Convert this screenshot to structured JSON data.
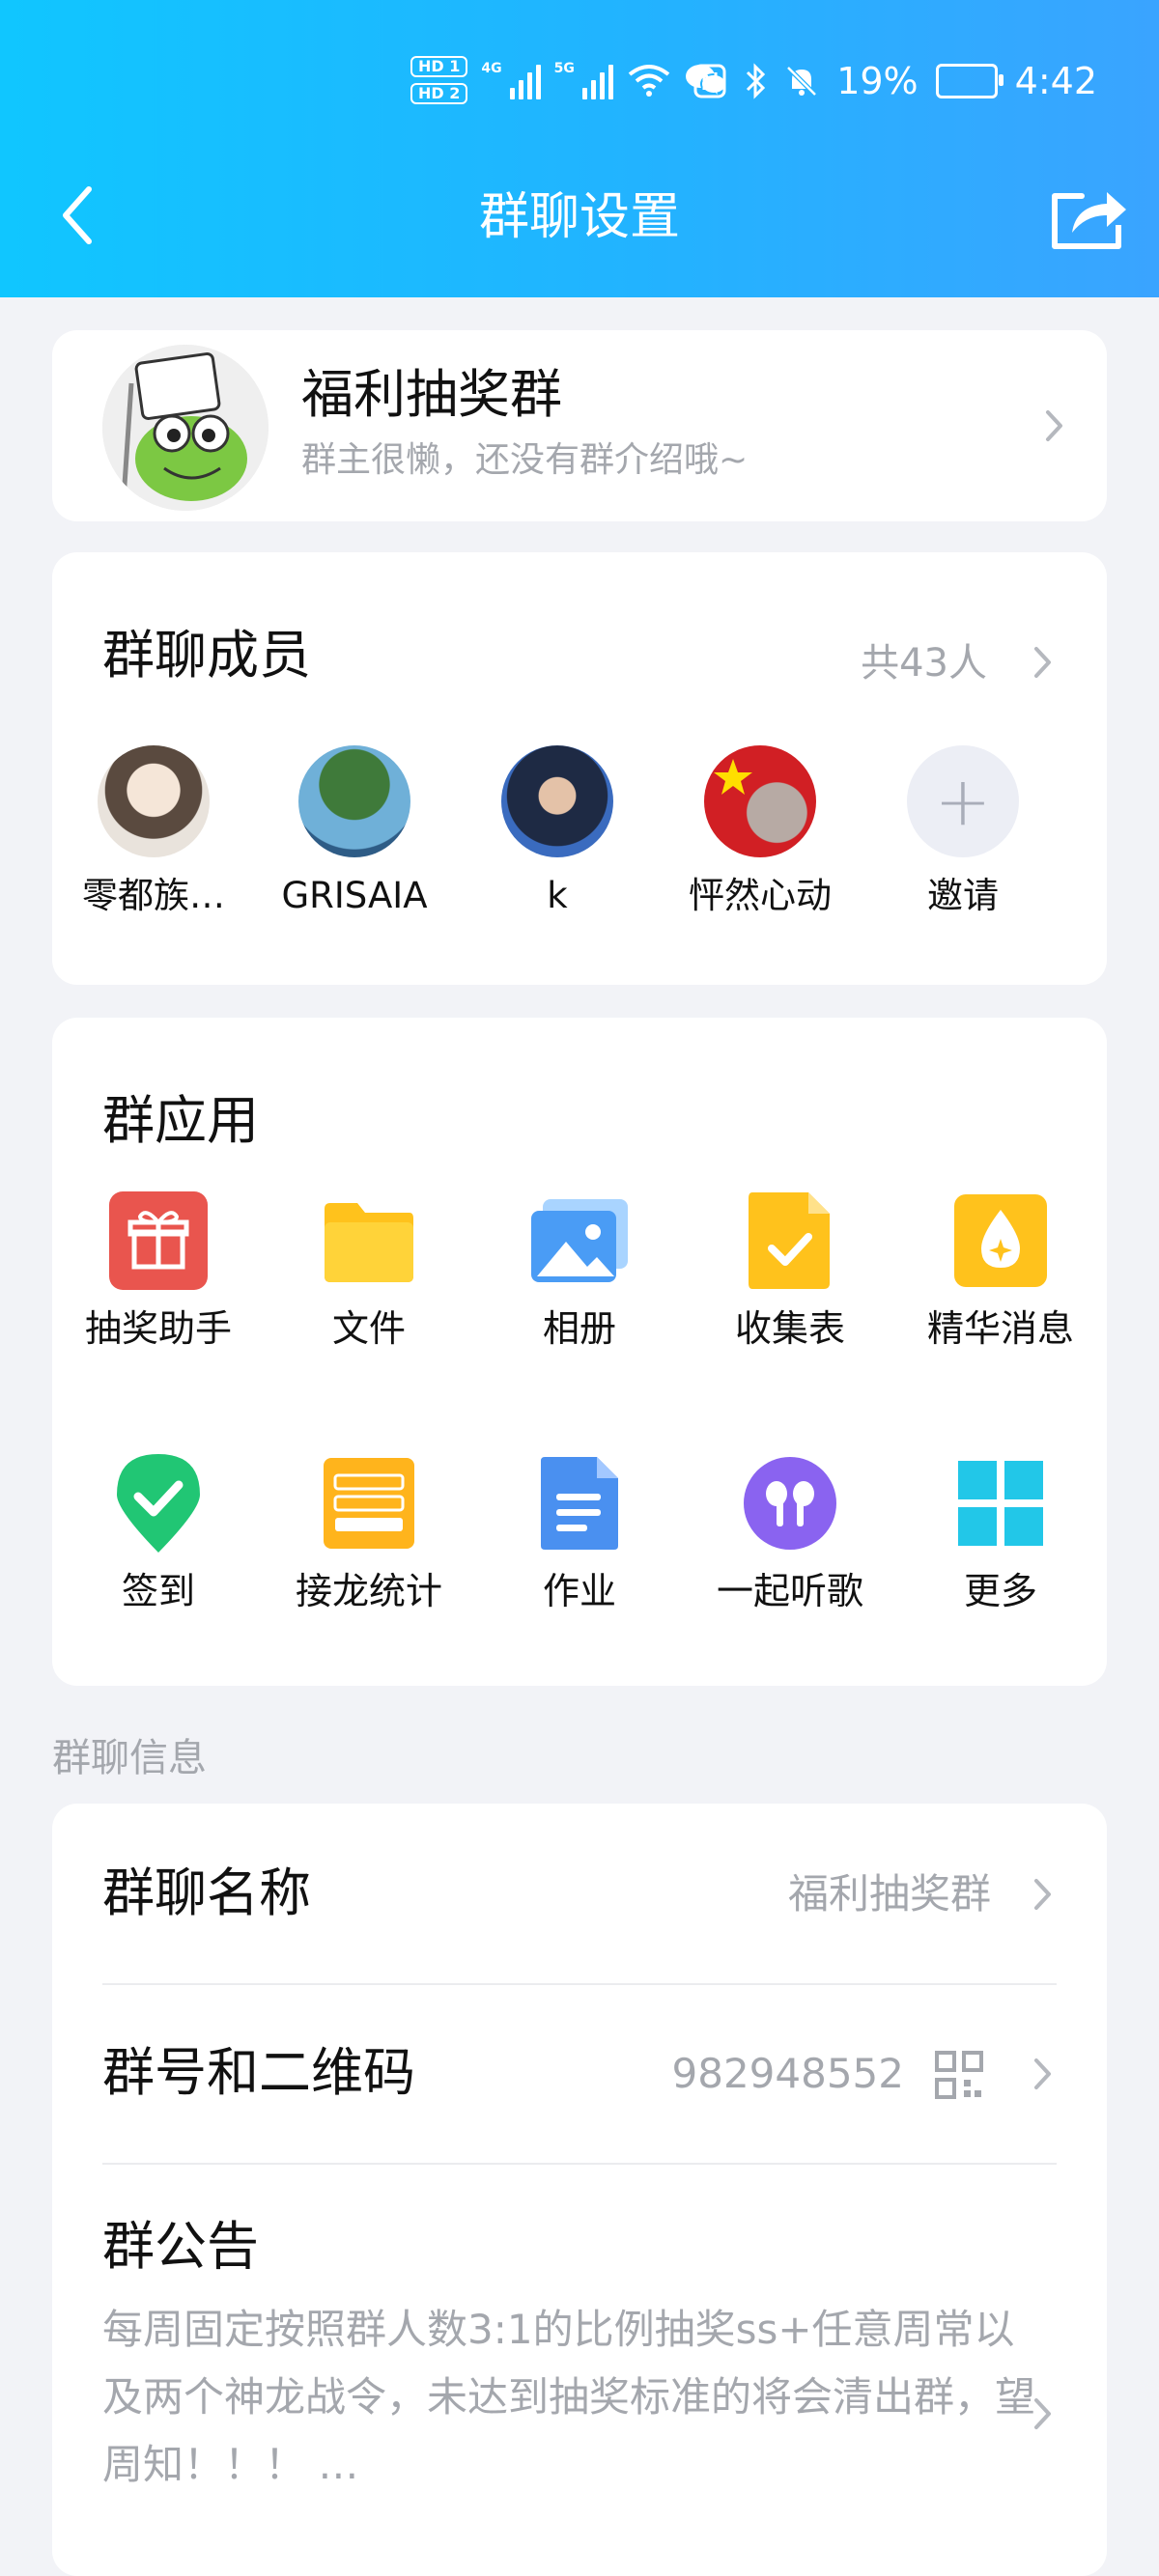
{
  "status_bar": {
    "hd1": "HD 1",
    "hd2": "HD 2",
    "net1": "4G",
    "net2": "5G",
    "battery": "19%",
    "time": "4:42"
  },
  "header": {
    "title": "群聊设置"
  },
  "group": {
    "name": "福利抽奖群",
    "description": "群主很懒，还没有群介绍哦~"
  },
  "members": {
    "title": "群聊成员",
    "count": "共43人",
    "list": [
      {
        "name": "零都族…"
      },
      {
        "name": "GRISAIA"
      },
      {
        "name": "k"
      },
      {
        "name": "怦然心动"
      },
      {
        "name": "邀请"
      }
    ]
  },
  "apps": {
    "title": "群应用",
    "items": [
      {
        "label": "抽奖助手",
        "icon": "gift-icon"
      },
      {
        "label": "文件",
        "icon": "folder-icon"
      },
      {
        "label": "相册",
        "icon": "photo-album-icon"
      },
      {
        "label": "收集表",
        "icon": "collection-form-icon"
      },
      {
        "label": "精华消息",
        "icon": "essence-message-icon"
      },
      {
        "label": "签到",
        "icon": "checkin-icon"
      },
      {
        "label": "接龙统计",
        "icon": "relay-stats-icon"
      },
      {
        "label": "作业",
        "icon": "homework-icon"
      },
      {
        "label": "一起听歌",
        "icon": "earbuds-icon"
      },
      {
        "label": "更多",
        "icon": "more-grid-icon"
      }
    ]
  },
  "info": {
    "section_label": "群聊信息",
    "name_label": "群聊名称",
    "name_value": "福利抽奖群",
    "number_label": "群号和二维码",
    "number_value": "982948552",
    "notice_label": "群公告",
    "notice_text": "每周固定按照群人数3:1的比例抽奖ss+任意周常以及两个神龙战令，未达到抽奖标准的将会清出群，望周知！！！ …"
  },
  "colors": {
    "header_gradient_start": "#10c6ff",
    "header_gradient_end": "#3aa4ff",
    "background": "#f2f3f7",
    "secondary_text": "#a4a7ad"
  }
}
